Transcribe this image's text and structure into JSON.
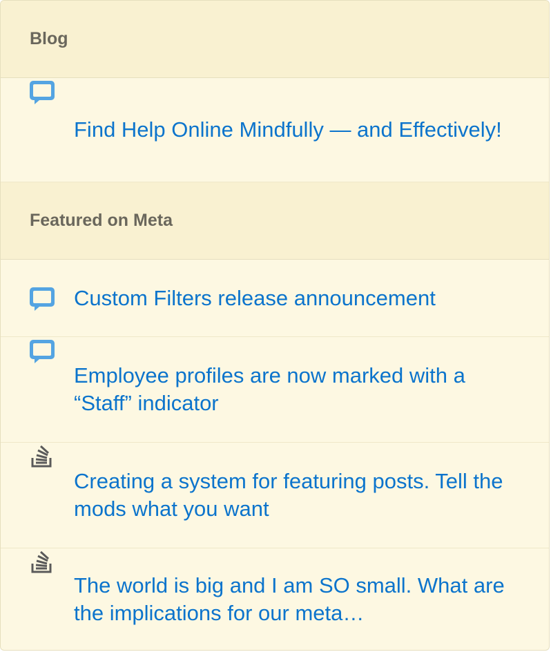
{
  "blog": {
    "header": "Blog",
    "items": [
      {
        "icon": "chat-bubble-icon",
        "label": "Find Help Online Mindfully — and Effectively!"
      }
    ]
  },
  "meta": {
    "header": "Featured on Meta",
    "items": [
      {
        "icon": "chat-bubble-icon",
        "label": "Custom Filters release announcement"
      },
      {
        "icon": "chat-bubble-icon",
        "label": "Employee profiles are now marked with a “Staff” indicator"
      },
      {
        "icon": "stack-exchange-icon",
        "label": "Creating a system for featuring posts. Tell the mods what you want"
      },
      {
        "icon": "stack-exchange-icon",
        "label": "The world is big and I am SO small. What are the implications for our meta…"
      }
    ]
  },
  "colors": {
    "background": "#fdf8e2",
    "header_background": "#f9f1d1",
    "link": "#0c74cc",
    "header_text": "#6a675c",
    "icon_blue": "#54a4e2"
  }
}
